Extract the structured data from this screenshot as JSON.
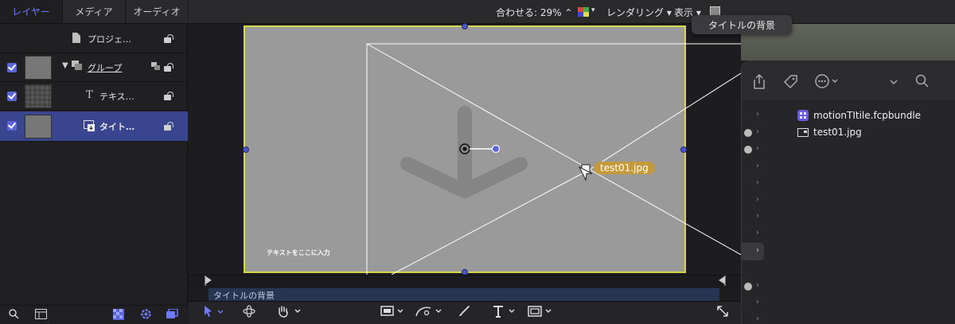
{
  "panel_tabs": [
    {
      "label": "レイヤー",
      "active": true
    },
    {
      "label": "メディア",
      "active": false
    },
    {
      "label": "オーディオ",
      "active": false
    }
  ],
  "layers": [
    {
      "name": "プロジェ…",
      "type": "project"
    },
    {
      "name": "グループ",
      "type": "group"
    },
    {
      "name": "テキス…",
      "type": "text"
    },
    {
      "name": "タイト…",
      "type": "image",
      "selected": true
    }
  ],
  "top_bar": {
    "fit_label": "合わせる: 29%",
    "render_label": "レンダリング",
    "view_label": "表示"
  },
  "tooltip": "タイトルの背景",
  "canvas": {
    "text_placeholder": "テキストをここに入力",
    "file_badge": "test01.jpg"
  },
  "finder": {
    "files": [
      "motionTItile.fcpbundle",
      "test01.jpg"
    ]
  },
  "timeline": {
    "label": "タイトルの背景"
  },
  "colors": {
    "accent": "#6d79ff",
    "selected_row": "#3a4590",
    "canvas_border": "#d8d74a",
    "badge": "#c49a3a"
  }
}
